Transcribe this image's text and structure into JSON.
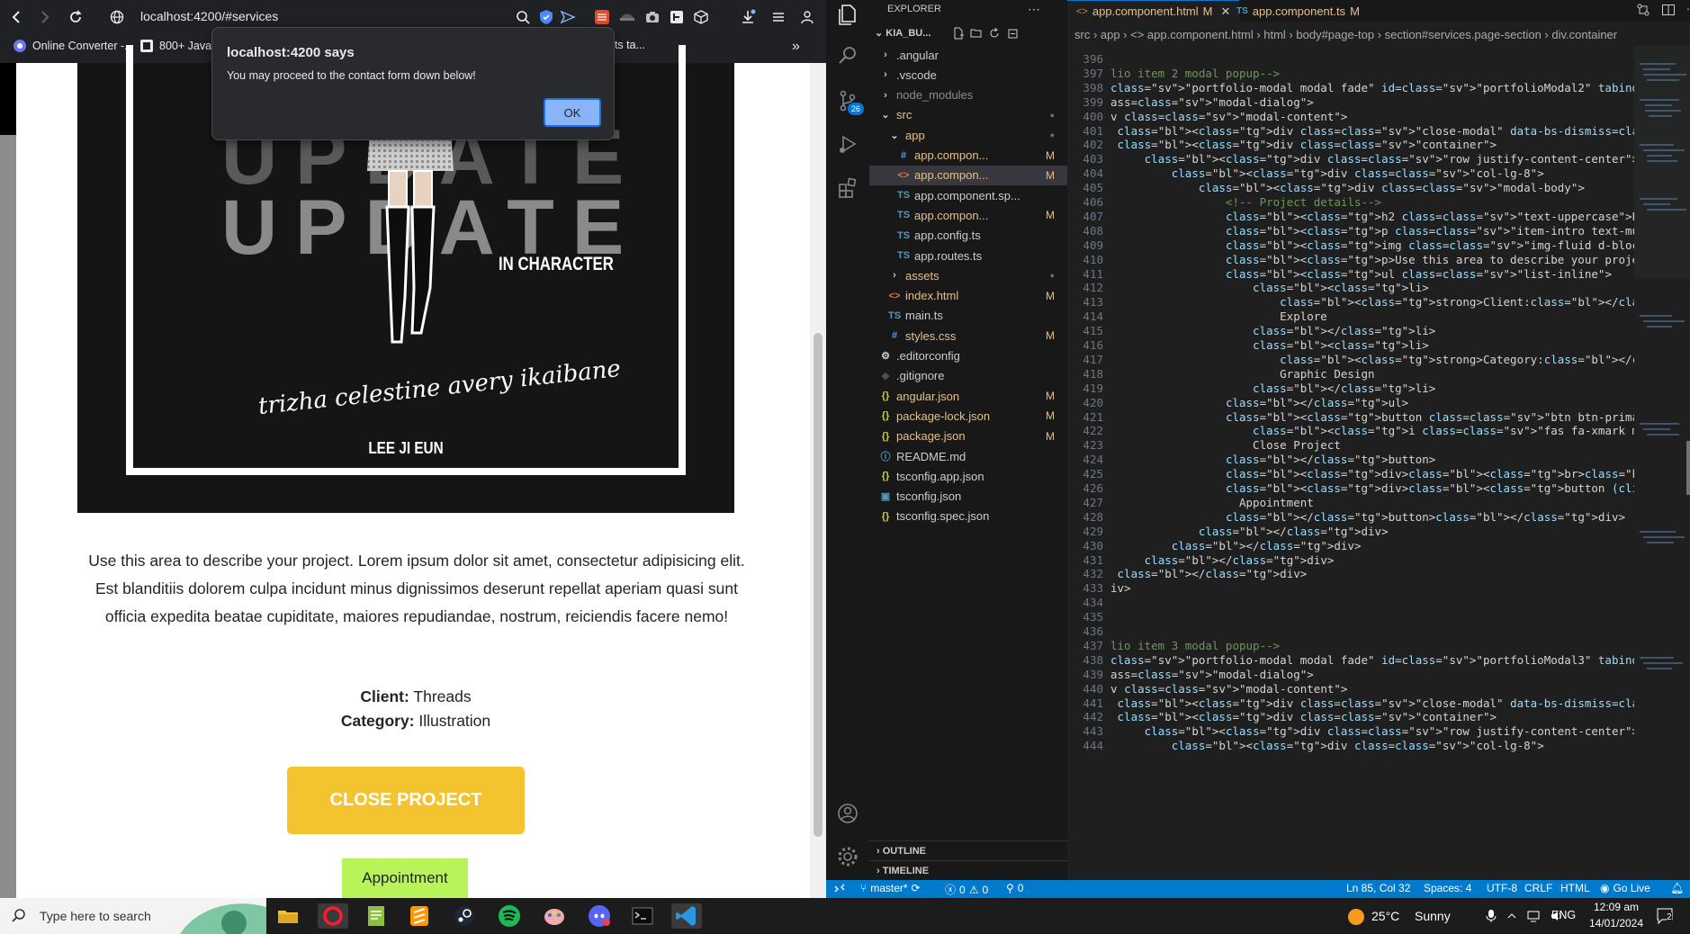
{
  "browser": {
    "url": "localhost:4200/#services",
    "bookmarks": [
      {
        "label": "Online Converter -..."
      },
      {
        "label": "800+ Java"
      },
      {
        "label": "ets ta..."
      }
    ],
    "more": "»"
  },
  "page": {
    "poster": {
      "big1": "UPDATE",
      "big2": "UPDATE",
      "in_character": "IN CHARACTER",
      "signature": "trizha celestine avery ikaibane",
      "author": "LEE JI EUN"
    },
    "description": "Use this area to describe your project. Lorem ipsum dolor sit amet, consectetur adipisicing elit. Est blanditiis dolorem culpa incidunt minus dignissimos deserunt repellat aperiam quasi sunt officia expedita beatae cupiditate, maiores repudiandae, nostrum, reiciendis facere nemo!",
    "client_label": "Client:",
    "client_value": "Threads",
    "category_label": "Category:",
    "category_value": "Illustration",
    "close_label": "CLOSE PROJECT",
    "appointment_label": "Appointment"
  },
  "dialog": {
    "title": "localhost:4200 says",
    "message": "You may proceed to the contact form down below!",
    "ok": "OK"
  },
  "vscode": {
    "explorer_title": "EXPLORER",
    "project": "KIA_BU...",
    "scm_badge": "26",
    "tree": [
      {
        "name": ".angular",
        "indent": 1,
        "type": "folder",
        "status": ""
      },
      {
        "name": ".vscode",
        "indent": 1,
        "type": "folder",
        "status": ""
      },
      {
        "name": "node_modules",
        "indent": 1,
        "type": "folder",
        "status": ""
      },
      {
        "name": "src",
        "indent": 1,
        "type": "folder-open",
        "status": "●"
      },
      {
        "name": "app",
        "indent": 2,
        "type": "folder-open",
        "status": "●"
      },
      {
        "name": "app.compon...",
        "indent": 3,
        "type": "css",
        "status": "M"
      },
      {
        "name": "app.compon...",
        "indent": 3,
        "type": "html",
        "status": "M",
        "selected": true
      },
      {
        "name": "app.component.sp...",
        "indent": 3,
        "type": "ts",
        "status": ""
      },
      {
        "name": "app.compon...",
        "indent": 3,
        "type": "ts",
        "status": "M"
      },
      {
        "name": "app.config.ts",
        "indent": 3,
        "type": "ts",
        "status": ""
      },
      {
        "name": "app.routes.ts",
        "indent": 3,
        "type": "ts",
        "status": ""
      },
      {
        "name": "assets",
        "indent": 2,
        "type": "folder",
        "status": "●"
      },
      {
        "name": "index.html",
        "indent": 2,
        "type": "html",
        "status": "M"
      },
      {
        "name": "main.ts",
        "indent": 2,
        "type": "ts",
        "status": ""
      },
      {
        "name": "styles.css",
        "indent": 2,
        "type": "css",
        "status": "M"
      },
      {
        "name": ".editorconfig",
        "indent": 1,
        "type": "gear",
        "status": ""
      },
      {
        "name": ".gitignore",
        "indent": 1,
        "type": "git",
        "status": ""
      },
      {
        "name": "angular.json",
        "indent": 1,
        "type": "json",
        "status": "M"
      },
      {
        "name": "package-lock.json",
        "indent": 1,
        "type": "json",
        "status": "M"
      },
      {
        "name": "package.json",
        "indent": 1,
        "type": "json",
        "status": "M"
      },
      {
        "name": "README.md",
        "indent": 1,
        "type": "info",
        "status": ""
      },
      {
        "name": "tsconfig.app.json",
        "indent": 1,
        "type": "json",
        "status": ""
      },
      {
        "name": "tsconfig.json",
        "indent": 1,
        "type": "tsjson",
        "status": ""
      },
      {
        "name": "tsconfig.spec.json",
        "indent": 1,
        "type": "json",
        "status": ""
      }
    ],
    "outline": "OUTLINE",
    "timeline": "TIMELINE",
    "tabs": [
      {
        "label": "app.component.html",
        "status": "M",
        "icon": "<>"
      },
      {
        "label": "app.component.ts",
        "status": "M",
        "icon": "TS"
      }
    ],
    "breadcrumb": "src › app › <> app.component.html › html › body#page-top › section#services.page-section › div.container",
    "line_start": 396,
    "code": [
      "",
      "lio item 2 modal popup-->",
      "\"portfolio-modal modal fade\" id=\"portfolioModal2\" tabindex=\"-1\" role=\"dialo",
      "ass=\"modal-dialog\">",
      "v class=\"modal-content\">",
      " <div class=\"close-modal\" data-bs-dismiss=\"modal\"><img src=\"assets/img/clos",
      " <div class=\"container\">",
      "     <div class=\"row justify-content-center\">",
      "         <div class=\"col-lg-8\">",
      "             <div class=\"modal-body\">",
      "                 <!-- Project details-->",
      "                 <h2 class=\"text-uppercase\">Project Name</h2>",
      "                 <p class=\"item-intro text-muted\">Lorem ipsum dolor sit ame",
      "                 <img class=\"img-fluid d-block mx-auto\" src=\"assets/img/por",
      "                 <p>Use this area to describe your project. Lorem ipsum dol",
      "                 <ul class=\"list-inline\">",
      "                     <li>",
      "                         <strong>Client:</strong>",
      "                         Explore",
      "                     </li>",
      "                     <li>",
      "                         <strong>Category:</strong>",
      "                         Graphic Design",
      "                     </li>",
      "                 </ul>",
      "                 <button class=\"btn btn-primary btn-xl text-uppercase\" data",
      "                     <i class=\"fas fa-xmark me-1\"></i>",
      "                     Close Project",
      "                 </button>",
      "                 <div><br></div>",
      "                 <div><button (click)=\"alertClick()\" style=\"border: none; p",
      "                   Appointment",
      "                 </button></div>",
      "             </div>",
      "         </div>",
      "     </div>",
      " </div>",
      "iv>",
      "",
      "",
      "",
      "lio item 3 modal popup-->",
      "\"portfolio-modal modal fade\" id=\"portfolioModal3\" tabindex=\"-1\" role=\"dialo",
      "ass=\"modal-dialog\">",
      "v class=\"modal-content\">",
      " <div class=\"close-modal\" data-bs-dismiss=\"modal\"><img src=\"assets/img/clos",
      " <div class=\"container\">",
      "     <div class=\"row justify-content-center\">",
      "         <div class=\"col-lg-8\">"
    ],
    "status": {
      "branch": "master*",
      "errors": "0",
      "warnings": "0",
      "ports": "0",
      "position": "Ln 85, Col 32",
      "spaces": "Spaces: 4",
      "encoding": "UTF-8",
      "eol": "CRLF",
      "lang": "HTML",
      "golive": "Go Live"
    }
  },
  "taskbar": {
    "search_placeholder": "Type here to search",
    "weather_temp": "25°C",
    "weather_text": "Sunny",
    "lang": "ENG",
    "time": "12:09 am",
    "date": "14/01/2024",
    "notif": "2"
  },
  "colors": {
    "accent": "#007acc",
    "close_btn": "#f4c430",
    "appointment_btn": "#b8f35a",
    "ok_btn": "#8ab4f8"
  }
}
